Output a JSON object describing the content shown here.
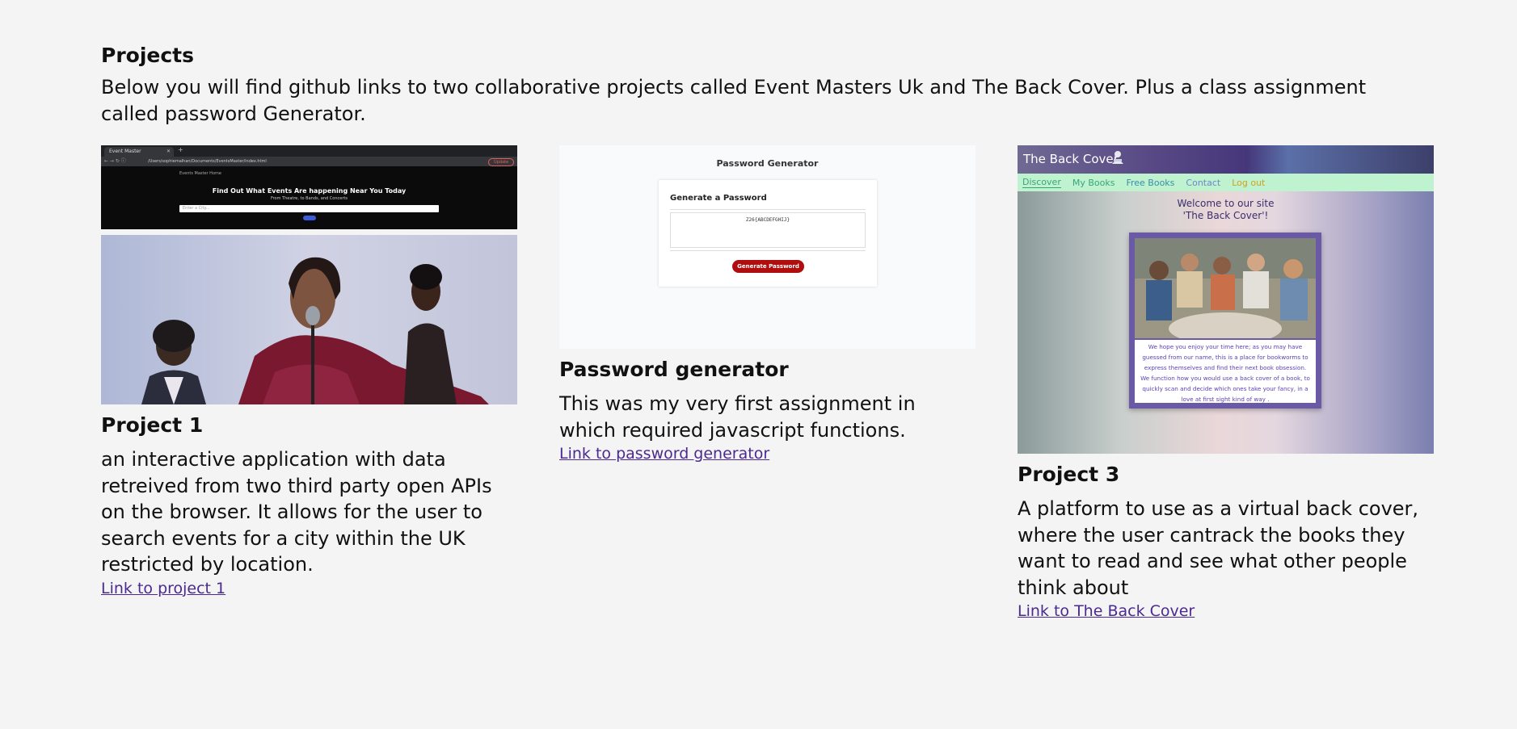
{
  "section": {
    "title": "Projects",
    "intro": "Below you will find github links to two collaborative projects called Event Masters Uk and The Back Cover. Plus a class assignment called password Generator."
  },
  "projects": [
    {
      "title": "Project 1",
      "description": "an interactive application with data retreived from two third party open APIs on the browser. It allows for the user to search events for a city within the UK restricted by location.",
      "link": "Link to project 1",
      "screenshot": {
        "tab_label": "Event Master",
        "url": "/Users/sophiemalhan/Documents/EventsMaster/index.html",
        "update_label": "Update",
        "menu": "Events Master   Home",
        "heading": "Find Out What Events Are happening Near You Today",
        "subheading": "From Theatre, to Bands, and Concerts",
        "search_placeholder": "Enter a City..."
      }
    },
    {
      "title": "Password generator",
      "description": "This was my very first assignment in which required javascript functions.",
      "link": "Link to password generator",
      "screenshot": {
        "page_title": "Password Generator",
        "card_title": "Generate a Password",
        "password": "Z26{ABCDEFGHIJ}",
        "button": "Generate Password"
      }
    },
    {
      "title": "Project 3",
      "description": "A platform to use as a virtual back cover, where the user cantrack the books they want to read and see what other people think about",
      "link": "Link to The Back Cover",
      "screenshot": {
        "logo": "The Back Cover",
        "nav": [
          "Discover",
          "My Books",
          "Free Books",
          "Contact",
          "Log out"
        ],
        "welcome_line1": "Welcome to our site",
        "welcome_line2": "'The Back Cover'!",
        "blurb": "We hope you enjoy your time here; as you may have guessed from our name, this is a place for bookworms to express themselves and find their next book obsession. We function how you would use a back cover of a book, to quickly scan and decide which ones take your fancy, in a love at first sight kind of way ."
      }
    }
  ],
  "colors": {
    "background": "#f4f4f4",
    "link": "#4b2a8f",
    "generate_button": "#b00e0e",
    "backcover_nav": "#bff3cf"
  }
}
